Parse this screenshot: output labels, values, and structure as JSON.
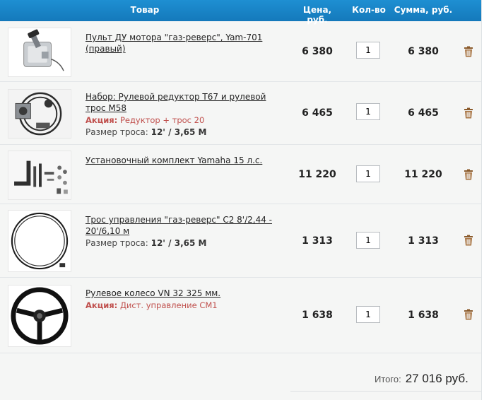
{
  "header": {
    "product": "Товар",
    "price": "Цена, руб.",
    "qty": "Кол-во",
    "sum": "Сумма, руб."
  },
  "items": [
    {
      "title": "Пульт ДУ мотора \"газ-реверс\", Yam-701 (правый)",
      "price": "6 380",
      "qty": "1",
      "sum": "6 380",
      "image": "remote-control-image"
    },
    {
      "title": "Набор: Рулевой редуктор Т67 и рулевой трос М58",
      "promo_label": "Акция:",
      "promo_text": "Редуктор + трос 20",
      "size_label": "Размер троса:",
      "size_value": "12' / 3,65 М",
      "price": "6 465",
      "qty": "1",
      "sum": "6 465",
      "image": "steering-kit-image"
    },
    {
      "title": "Установочный комплект Yamaha 15 л.с.",
      "price": "11 220",
      "qty": "1",
      "sum": "11 220",
      "image": "install-kit-image"
    },
    {
      "title": "Трос управления \"газ-реверс\" С2 8'/2,44 - 20'/6,10 м",
      "size_label": "Размер троса:",
      "size_value": "12' / 3,65 М",
      "price": "1 313",
      "qty": "1",
      "sum": "1 313",
      "image": "control-cable-image"
    },
    {
      "title": "Рулевое колесо VN 32 325 мм.",
      "promo_label": "Акция:",
      "promo_text": "Дист. управление СМ1",
      "price": "1 638",
      "qty": "1",
      "sum": "1 638",
      "image": "steering-wheel-image"
    }
  ],
  "total": {
    "label": "Итого:",
    "value": "27 016 руб."
  },
  "colors": {
    "header_bg": "#1a86c9",
    "promo": "#c0504d",
    "trash_icon": "#8a5a2b"
  }
}
